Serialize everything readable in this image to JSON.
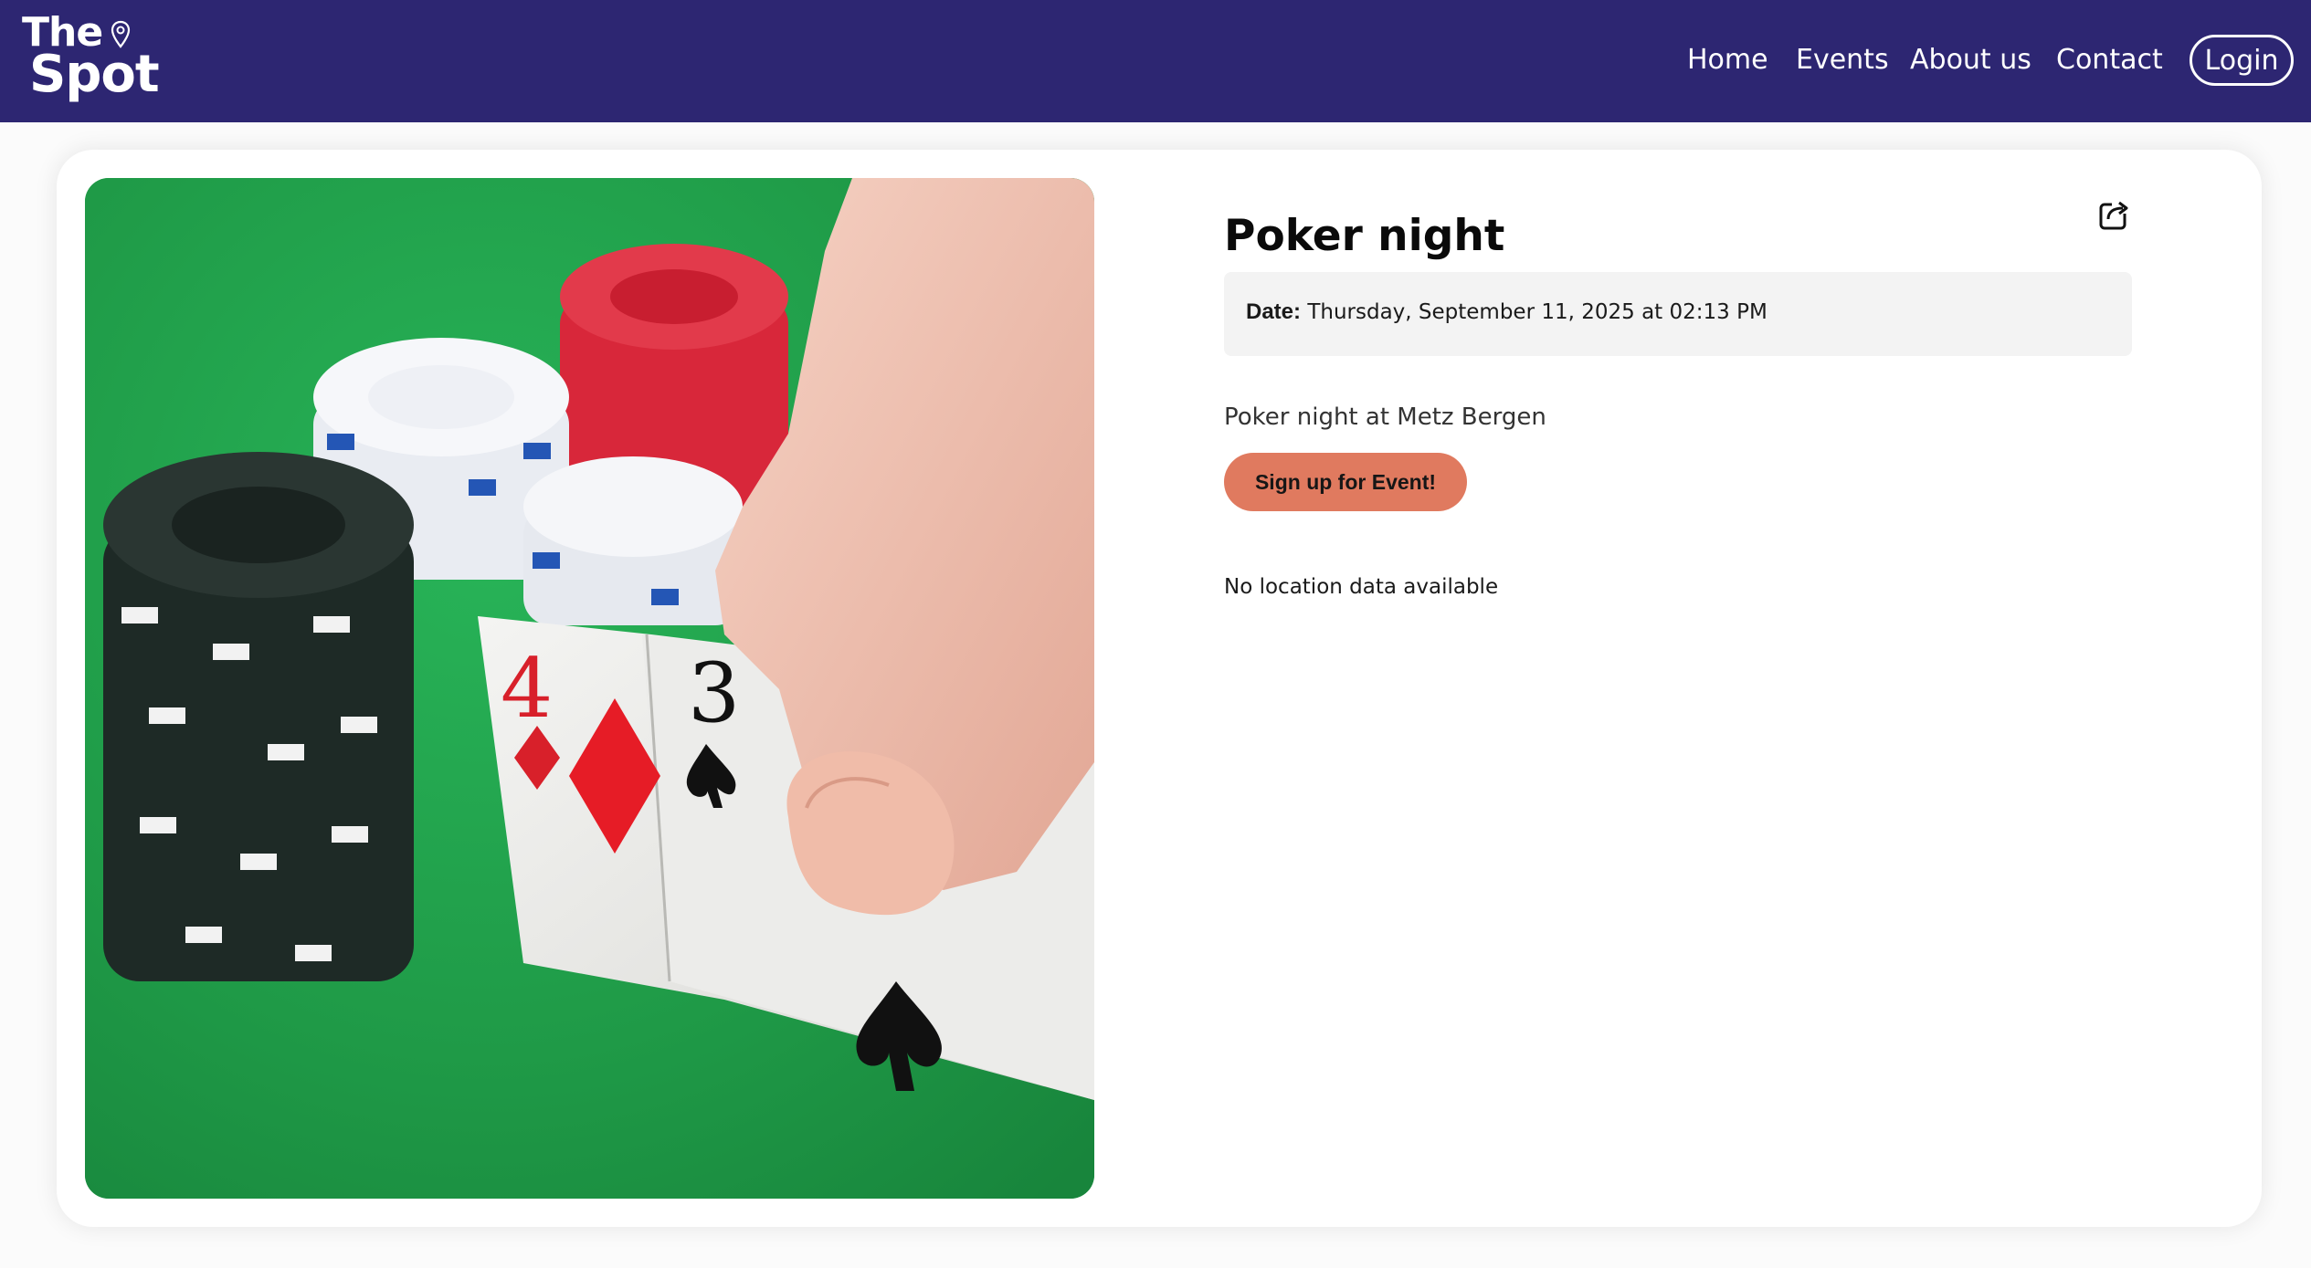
{
  "header": {
    "brand_line1": "The",
    "brand_line2": "Spot",
    "brand_color": "#2d2672",
    "nav": [
      {
        "label": "Home"
      },
      {
        "label": "Events"
      },
      {
        "label": "About us"
      },
      {
        "label": "Contact"
      }
    ],
    "login_label": "Login"
  },
  "event": {
    "title": "Poker night",
    "date_label": "Date:",
    "date_value": "Thursday, September 11, 2025 at 02:13 PM",
    "description": "Poker night at Metz Bergen",
    "signup_label": "Sign up for Event!",
    "signup_color": "#e07a5f",
    "location_text": "No location data available",
    "image_cards": [
      "4",
      "3"
    ]
  }
}
